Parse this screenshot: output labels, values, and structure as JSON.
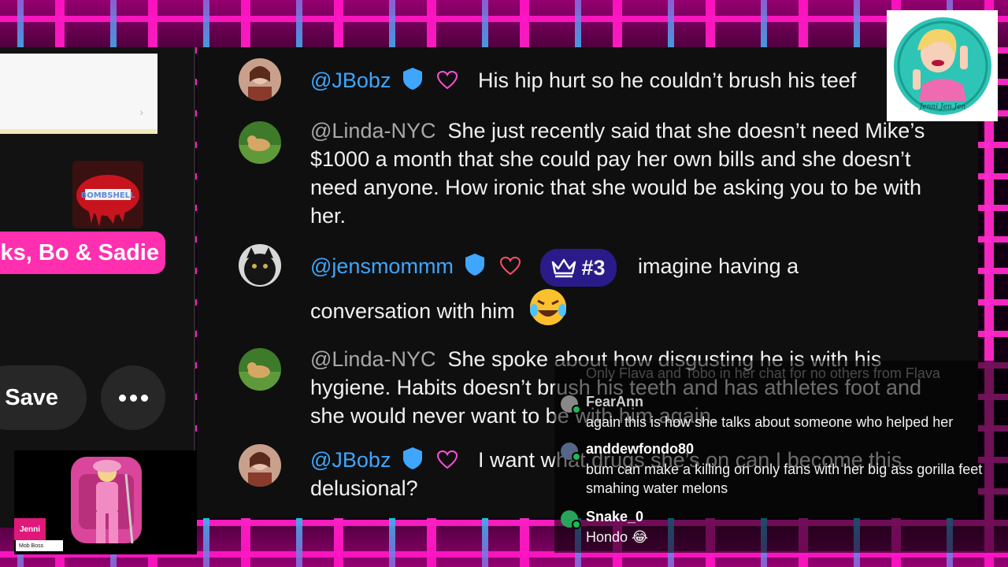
{
  "left_panel": {
    "tag_text": "ks, Bo & Sadie",
    "save_label": "Save",
    "sticker_text": "BOMBSHELL"
  },
  "cam": {
    "name": "Jenni",
    "sub": "Mob Boss"
  },
  "logo": {
    "text": "Jenni Jen Jen"
  },
  "messages": [
    {
      "author": "@JBobz",
      "text": "His hip hurt so he couldn’t brush his teef"
    },
    {
      "author": "@Linda-NYC",
      "text": "She just recently said that she doesn’t need Mike’s $1000 a month that she could pay her own bills and she doesn’t need anyone. How ironic that she would be asking you to be with her."
    },
    {
      "author": "@jensmommm",
      "rank": "#3",
      "text": "imagine having a",
      "text2": "conversation with him",
      "emoji": "😂"
    },
    {
      "author": "@Linda-NYC",
      "text": "She spoke about how disgusting he is with his hygiene. Habits doesn’t brush his teeth and has athletes foot and she would never want to be with him again."
    },
    {
      "author": "@JBobz",
      "text": "I want what drugs she’s on can I become this delusional?"
    }
  ],
  "overlay": {
    "ghost": "Only Flava and Tobo in her chat for no others from Flava",
    "rows": [
      {
        "name": "FearAnn",
        "msg": "again this is how she talks about someone who helped her",
        "color": "#888888"
      },
      {
        "name": "anddewfondo80",
        "msg": "bum can make a killing on only fans with her big ass gorilla feet smahing water melons",
        "color": "#556688"
      },
      {
        "name": "Snake_0",
        "msg": "Hondo 😂",
        "color": "#2aa35a"
      }
    ]
  }
}
